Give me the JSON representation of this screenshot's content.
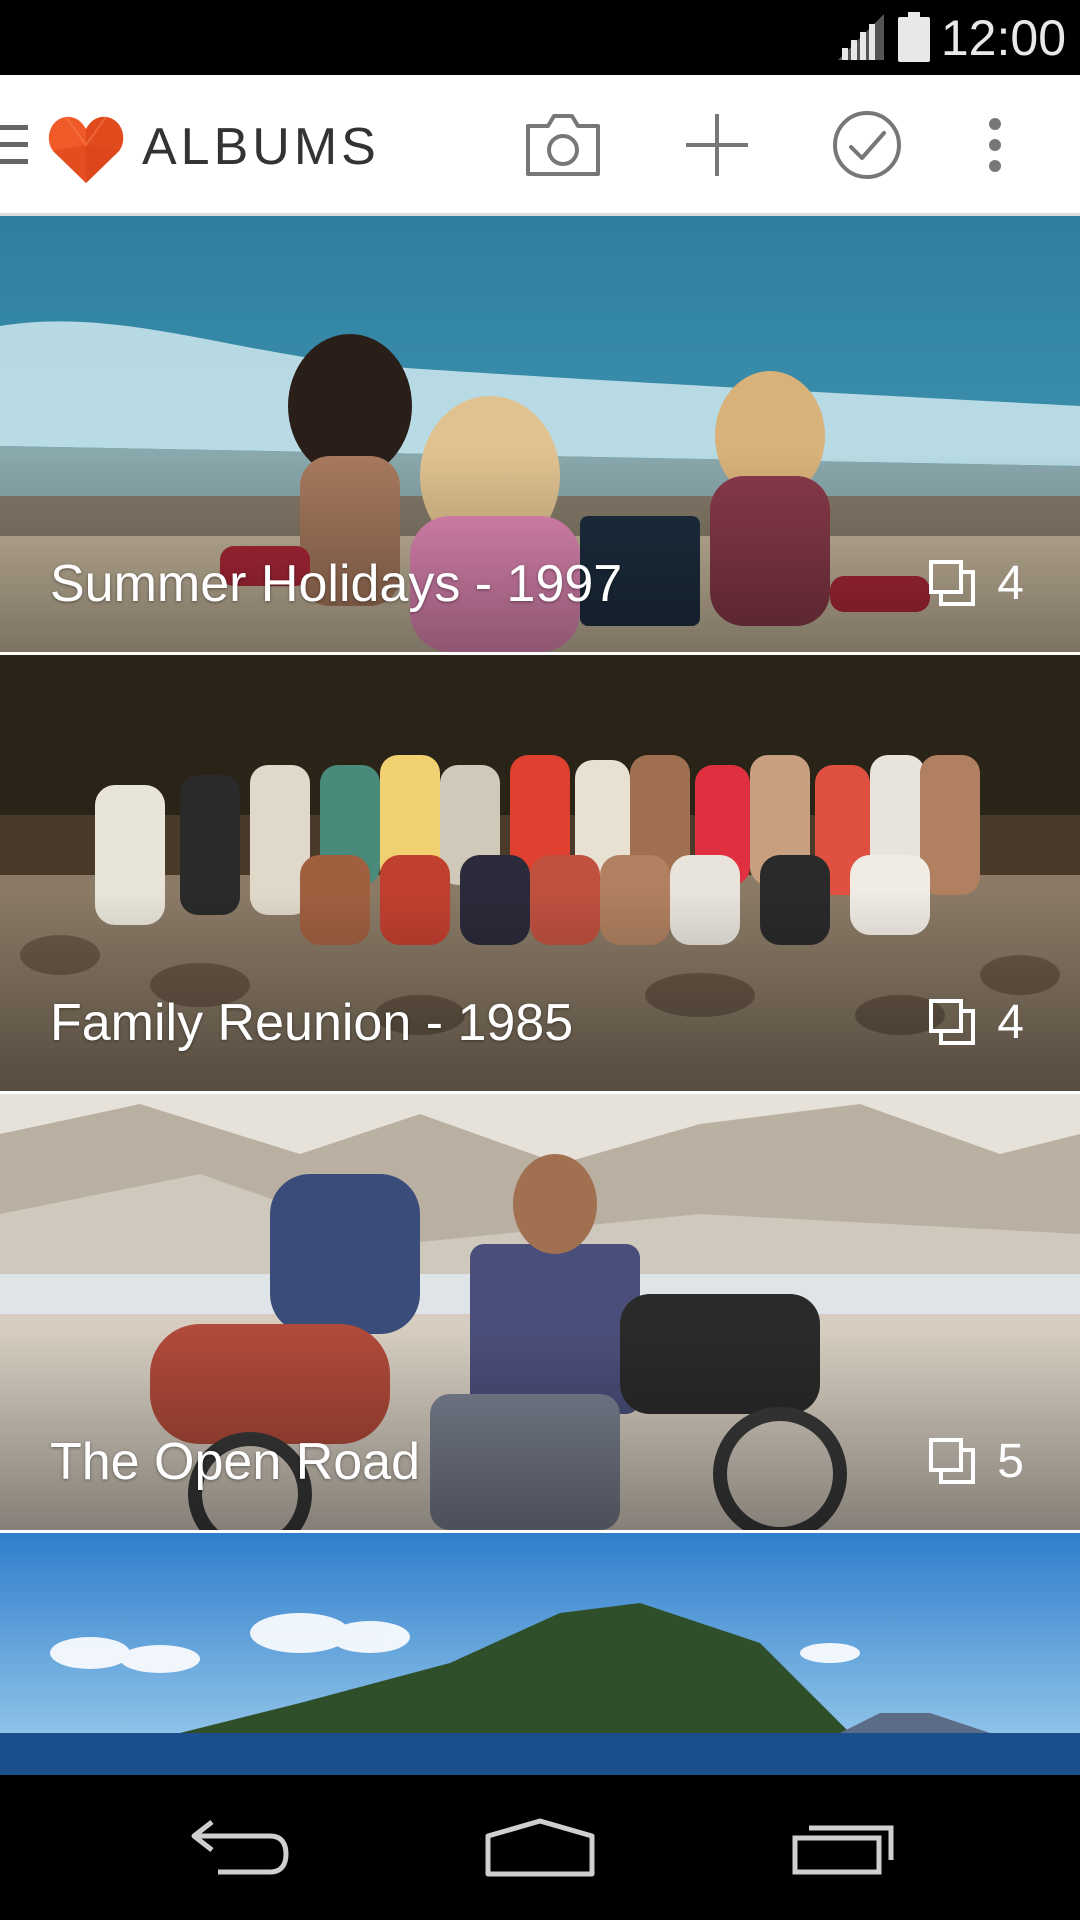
{
  "status_bar": {
    "time": "12:00",
    "icons": [
      "signal-icon",
      "battery-icon"
    ]
  },
  "app_bar": {
    "title": "ALBUMS",
    "logo": "heart-logo",
    "accent_color": "#f05a28",
    "actions": [
      {
        "name": "camera",
        "icon": "camera-icon"
      },
      {
        "name": "add",
        "icon": "plus-icon"
      },
      {
        "name": "select",
        "icon": "check-circle-icon"
      },
      {
        "name": "more",
        "icon": "more-vert-icon"
      }
    ]
  },
  "albums": [
    {
      "title": "Summer Holidays - 1997",
      "count": "4",
      "icon": "photos-stack-icon"
    },
    {
      "title": "Family Reunion - 1985",
      "count": "4",
      "icon": "photos-stack-icon"
    },
    {
      "title": "The Open Road",
      "count": "5",
      "icon": "photos-stack-icon"
    },
    {
      "title": "",
      "count": "",
      "icon": ""
    }
  ],
  "nav_bar": {
    "buttons": [
      "back-icon",
      "home-icon",
      "recents-icon"
    ]
  }
}
